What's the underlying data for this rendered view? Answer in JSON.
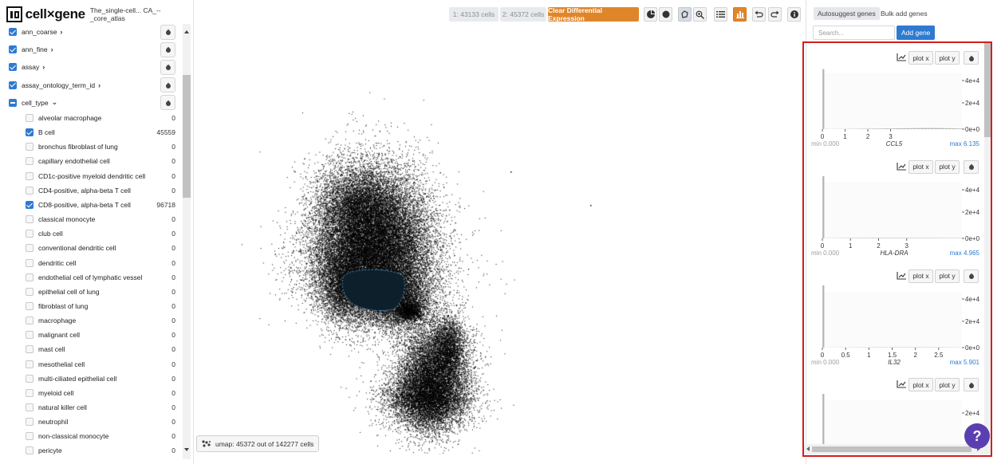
{
  "header": {
    "brand": "cell×gene",
    "dataset_title": "The_single-cell... CA_--_core_atlas"
  },
  "toolbar": {
    "selection1": "1: 43133 cells",
    "selection2": "2: 45372 cells",
    "clear_diff_label": "Clear Differential Expression",
    "icons": [
      "subset-icon",
      "reset-subset-icon",
      "lasso-icon",
      "zoom-icon",
      "categories-icon",
      "histogram-icon",
      "undo-icon",
      "redo-icon",
      "info-icon"
    ]
  },
  "categories": [
    {
      "label": "ann_coarse",
      "state": "on",
      "expanded": false
    },
    {
      "label": "ann_fine",
      "state": "on",
      "expanded": false
    },
    {
      "label": "assay",
      "state": "on",
      "expanded": false
    },
    {
      "label": "assay_ontology_term_id",
      "state": "on",
      "expanded": false
    },
    {
      "label": "cell_type",
      "state": "ind",
      "expanded": true
    }
  ],
  "cell_types": [
    {
      "label": "alveolar macrophage",
      "count": "0",
      "checked": false
    },
    {
      "label": "B cell",
      "count": "45559",
      "checked": true
    },
    {
      "label": "bronchus fibroblast of lung",
      "count": "0",
      "checked": false
    },
    {
      "label": "capillary endothelial cell",
      "count": "0",
      "checked": false
    },
    {
      "label": "CD1c-positive myeloid dendritic cell",
      "count": "0",
      "checked": false
    },
    {
      "label": "CD4-positive, alpha-beta T cell",
      "count": "0",
      "checked": false
    },
    {
      "label": "CD8-positive, alpha-beta T cell",
      "count": "96718",
      "checked": true
    },
    {
      "label": "classical monocyte",
      "count": "0",
      "checked": false
    },
    {
      "label": "club cell",
      "count": "0",
      "checked": false
    },
    {
      "label": "conventional dendritic cell",
      "count": "0",
      "checked": false
    },
    {
      "label": "dendritic cell",
      "count": "0",
      "checked": false
    },
    {
      "label": "endothelial cell of lymphatic vessel",
      "count": "0",
      "checked": false
    },
    {
      "label": "epithelial cell of lung",
      "count": "0",
      "checked": false
    },
    {
      "label": "fibroblast of lung",
      "count": "0",
      "checked": false
    },
    {
      "label": "macrophage",
      "count": "0",
      "checked": false
    },
    {
      "label": "malignant cell",
      "count": "0",
      "checked": false
    },
    {
      "label": "mast cell",
      "count": "0",
      "checked": false
    },
    {
      "label": "mesothelial cell",
      "count": "0",
      "checked": false
    },
    {
      "label": "multi-ciliated epithelial cell",
      "count": "0",
      "checked": false
    },
    {
      "label": "myeloid cell",
      "count": "0",
      "checked": false
    },
    {
      "label": "natural killer cell",
      "count": "0",
      "checked": false
    },
    {
      "label": "neutrophil",
      "count": "0",
      "checked": false
    },
    {
      "label": "non-classical monocyte",
      "count": "0",
      "checked": false
    },
    {
      "label": "pericyte",
      "count": "0",
      "checked": false
    }
  ],
  "embedding": {
    "label": "umap: 45372 out of 142277 cells"
  },
  "gene_panel": {
    "autosuggest_label": "Autosuggest genes",
    "bulk_label": "Bulk add genes",
    "search_placeholder": "Search...",
    "add_gene_label": "Add gene",
    "plot_x_label": "plot x",
    "plot_y_label": "plot y",
    "genes": [
      {
        "name": "CCL5",
        "min": "min 0.000",
        "max": "max 6.135",
        "xmax": 6.135,
        "xticks": [
          "0",
          "1",
          "2",
          "3"
        ],
        "xtick_values": [
          0,
          1,
          2,
          3
        ],
        "yticks": [
          "4e+4",
          "2e+4",
          "0e+0"
        ],
        "yrange": [
          0,
          40000
        ],
        "bins": [
          43000,
          150,
          60,
          80,
          100,
          120,
          140,
          170,
          190,
          210,
          240,
          260,
          290,
          310,
          340,
          370,
          400,
          420,
          460,
          480,
          520,
          560,
          600,
          640,
          670,
          700,
          730,
          760,
          790,
          800,
          800,
          800,
          790,
          760,
          730,
          700,
          650,
          600,
          530,
          440
        ]
      },
      {
        "name": "HLA-DRA",
        "min": "min 0.000",
        "max": "max 4.965",
        "xmax": 4.965,
        "xticks": [
          "0",
          "1",
          "2",
          "3"
        ],
        "xtick_values": [
          0,
          1,
          2,
          3
        ],
        "yticks": [
          "4e+4",
          "2e+4",
          "0e+0"
        ],
        "yrange": [
          0,
          40000
        ],
        "bins": [
          47000,
          120,
          140,
          160,
          180,
          200,
          220,
          240,
          260,
          270,
          280,
          290,
          300,
          310,
          320,
          330,
          340,
          340,
          340,
          340,
          340,
          340,
          340,
          330,
          330,
          320,
          320,
          310,
          310,
          300,
          300,
          290,
          290,
          280,
          280,
          270,
          270,
          260,
          260,
          250
        ]
      },
      {
        "name": "IL32",
        "min": "min 0.000",
        "max": "max 5.901",
        "xmax": 3.0,
        "xticks": [
          "0",
          "0.5",
          "1",
          "1.5",
          "2",
          "2.5"
        ],
        "xtick_values": [
          0,
          0.5,
          1,
          1.5,
          2,
          2.5
        ],
        "yticks": [
          "4e+4",
          "2e+4",
          "0e+0"
        ],
        "yrange": [
          0,
          40000
        ],
        "bins": [
          48000,
          70,
          80,
          90,
          100,
          110,
          120,
          130,
          140,
          150,
          160,
          170,
          180,
          190,
          200,
          210,
          220,
          220,
          230,
          230,
          230,
          240,
          240,
          240,
          240,
          240,
          240,
          240,
          230,
          230,
          230,
          220,
          220,
          210,
          200,
          190,
          180,
          160,
          140,
          120
        ]
      },
      {
        "name": "",
        "min": "",
        "max": "",
        "xmax": 5,
        "xticks": [],
        "xtick_values": [],
        "yticks": [
          "2e+4"
        ],
        "yrange": [
          0,
          40000
        ],
        "bins": [
          45000
        ]
      }
    ]
  },
  "help_label": "?",
  "colors": {
    "accent": "#2e7ad1",
    "orange": "#e0862a",
    "selection": "#0d1f2a",
    "lasso_border": "#4a90c8",
    "highlight_box": "#d21f1f",
    "help": "#5b3fb0"
  }
}
